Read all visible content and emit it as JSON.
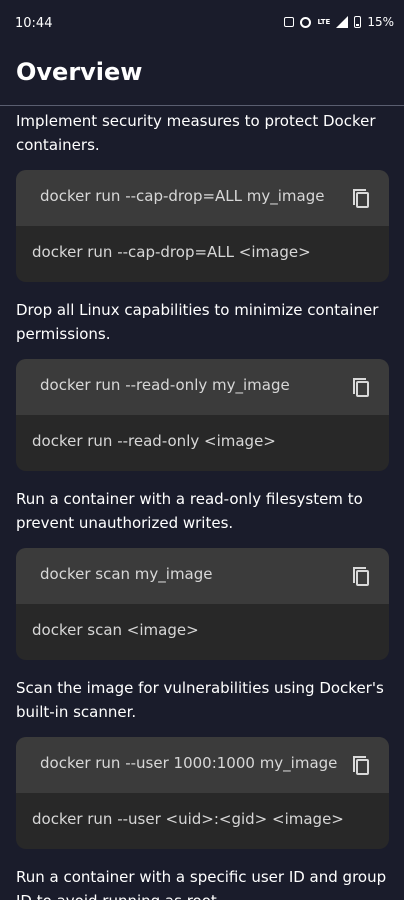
{
  "status_bar": {
    "time": "10:44",
    "battery": "15%",
    "network": "LTE"
  },
  "header": {
    "title": "Overview"
  },
  "sections": [
    {
      "description": "Implement security measures to protect Docker containers.",
      "command": "docker run --cap-drop=ALL my_image",
      "syntax": "docker run --cap-drop=ALL <image>"
    },
    {
      "description": "Drop all Linux capabilities to minimize container permissions.",
      "command": "docker run --read-only my_image",
      "syntax": "docker run --read-only <image>"
    },
    {
      "description": "Run a container with a read-only filesystem to prevent unauthorized writes.",
      "command": "docker scan my_image",
      "syntax": "docker scan <image>"
    },
    {
      "description": "Scan the image for vulnerabilities using Docker's built-in scanner.",
      "command": "docker run --user 1000:1000 my_image",
      "syntax": "docker run --user <uid>:<gid> <image>"
    },
    {
      "description": "Run a container with a specific user ID and group ID to avoid running as root."
    }
  ]
}
